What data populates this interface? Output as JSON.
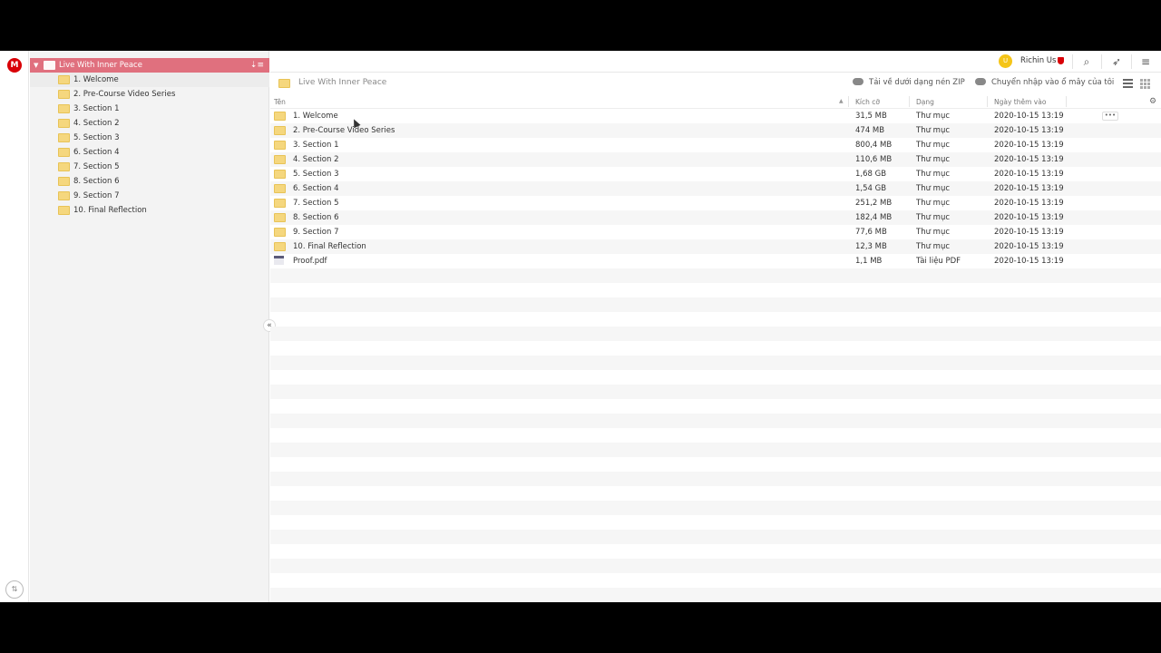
{
  "app": {
    "logo_letter": "M"
  },
  "user": {
    "initials": "U",
    "name": "Richin Us"
  },
  "tree": {
    "root_label": "Live With Inner Peace",
    "items": [
      {
        "label": "1. Welcome",
        "selected": true
      },
      {
        "label": "2. Pre-Course Video Series"
      },
      {
        "label": "3. Section 1"
      },
      {
        "label": "4. Section 2"
      },
      {
        "label": "5. Section 3"
      },
      {
        "label": "6. Section 4"
      },
      {
        "label": "7. Section 5"
      },
      {
        "label": "8. Section 6"
      },
      {
        "label": "9. Section 7"
      },
      {
        "label": "10. Final Reflection"
      }
    ]
  },
  "path": {
    "title": "Live With Inner Peace"
  },
  "actions": {
    "download_zip": "Tải về dưới dạng nén ZIP",
    "import_to_drive": "Chuyển nhập vào ổ mây của tôi"
  },
  "table": {
    "headers": {
      "name": "Tên",
      "size": "Kích cỡ",
      "type": "Dạng",
      "date": "Ngày thêm vào"
    },
    "rows": [
      {
        "name": "1. Welcome",
        "size": "31,5 MB",
        "type": "Thư mục",
        "date": "2020-10-15 13:19",
        "kind": "folder"
      },
      {
        "name": "2. Pre-Course Video Series",
        "size": "474 MB",
        "type": "Thư mục",
        "date": "2020-10-15 13:19",
        "kind": "folder"
      },
      {
        "name": "3. Section 1",
        "size": "800,4 MB",
        "type": "Thư mục",
        "date": "2020-10-15 13:19",
        "kind": "folder"
      },
      {
        "name": "4. Section 2",
        "size": "110,6 MB",
        "type": "Thư mục",
        "date": "2020-10-15 13:19",
        "kind": "folder"
      },
      {
        "name": "5. Section 3",
        "size": "1,68 GB",
        "type": "Thư mục",
        "date": "2020-10-15 13:19",
        "kind": "folder"
      },
      {
        "name": "6. Section 4",
        "size": "1,54 GB",
        "type": "Thư mục",
        "date": "2020-10-15 13:19",
        "kind": "folder"
      },
      {
        "name": "7. Section 5",
        "size": "251,2 MB",
        "type": "Thư mục",
        "date": "2020-10-15 13:19",
        "kind": "folder"
      },
      {
        "name": "8. Section 6",
        "size": "182,4 MB",
        "type": "Thư mục",
        "date": "2020-10-15 13:19",
        "kind": "folder"
      },
      {
        "name": "9. Section 7",
        "size": "77,6 MB",
        "type": "Thư mục",
        "date": "2020-10-15 13:19",
        "kind": "folder"
      },
      {
        "name": "10. Final Reflection",
        "size": "12,3 MB",
        "type": "Thư mục",
        "date": "2020-10-15 13:19",
        "kind": "folder"
      },
      {
        "name": "Proof.pdf",
        "size": "1,1 MB",
        "type": "Tài liệu PDF",
        "date": "2020-10-15 13:19",
        "kind": "pdf"
      }
    ]
  },
  "colors": {
    "accent": "#e0707e",
    "brand": "#d90007",
    "folder": "#f5d77e"
  }
}
